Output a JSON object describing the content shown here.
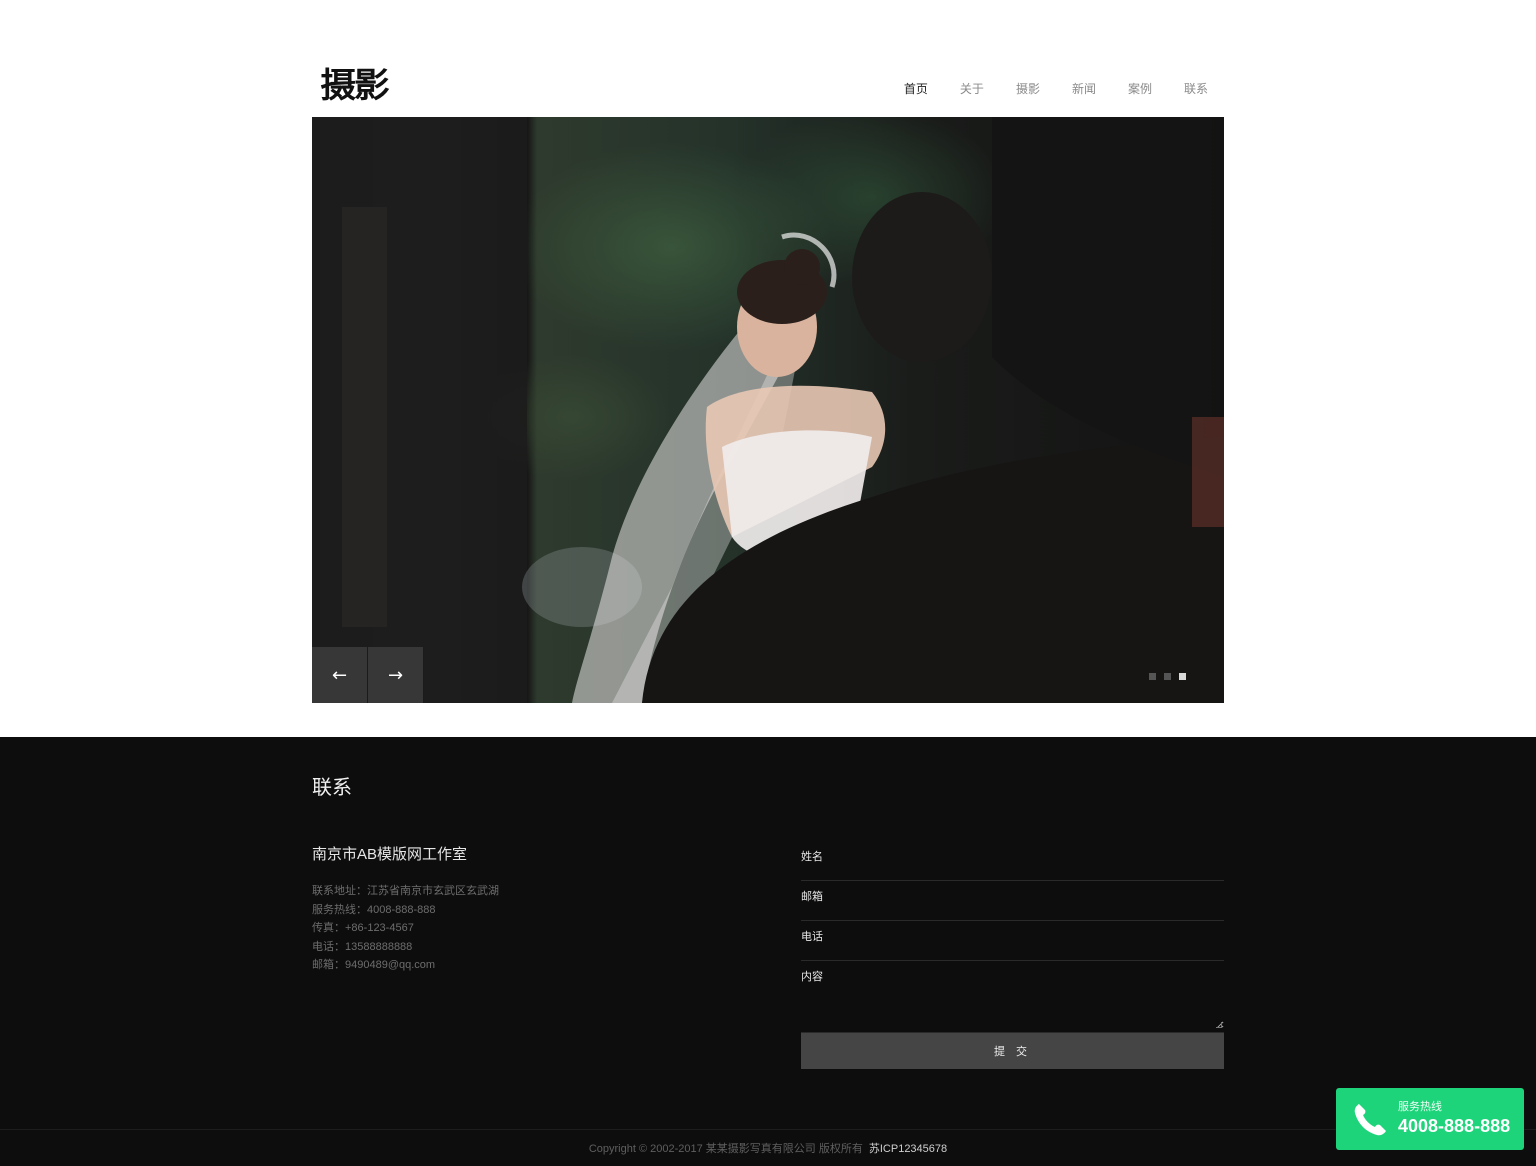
{
  "header": {
    "logo": "摄影",
    "nav": [
      {
        "label": "首页",
        "active": true
      },
      {
        "label": "关于",
        "active": false
      },
      {
        "label": "摄影",
        "active": false
      },
      {
        "label": "新闻",
        "active": false
      },
      {
        "label": "案例",
        "active": false
      },
      {
        "label": "联系",
        "active": false
      }
    ]
  },
  "hero": {
    "prev_label": "←",
    "next_label": "→",
    "slide_count": 3,
    "active_slide": 3
  },
  "contact": {
    "title": "联系",
    "company": "南京市AB模版网工作室",
    "info": [
      "联系地址：江苏省南京市玄武区玄武湖",
      "服务热线：4008-888-888",
      "传真：+86-123-4567",
      "电话：13588888888",
      "邮箱：9490489@qq.com"
    ],
    "form": {
      "name_label": "姓名",
      "email_label": "邮箱",
      "phone_label": "电话",
      "content_label": "内容",
      "submit_label": "提 交"
    }
  },
  "footer": {
    "copyright": "Copyright © 2002-2017 某某摄影写真有限公司 版权所有",
    "icp": "苏ICP12345678"
  },
  "hotline": {
    "label": "服务热线",
    "number": "4008-888-888"
  },
  "colors": {
    "footer_bg": "#0d0d0d",
    "hotline_bg": "#1ed47a",
    "submit_bg": "#454545"
  }
}
